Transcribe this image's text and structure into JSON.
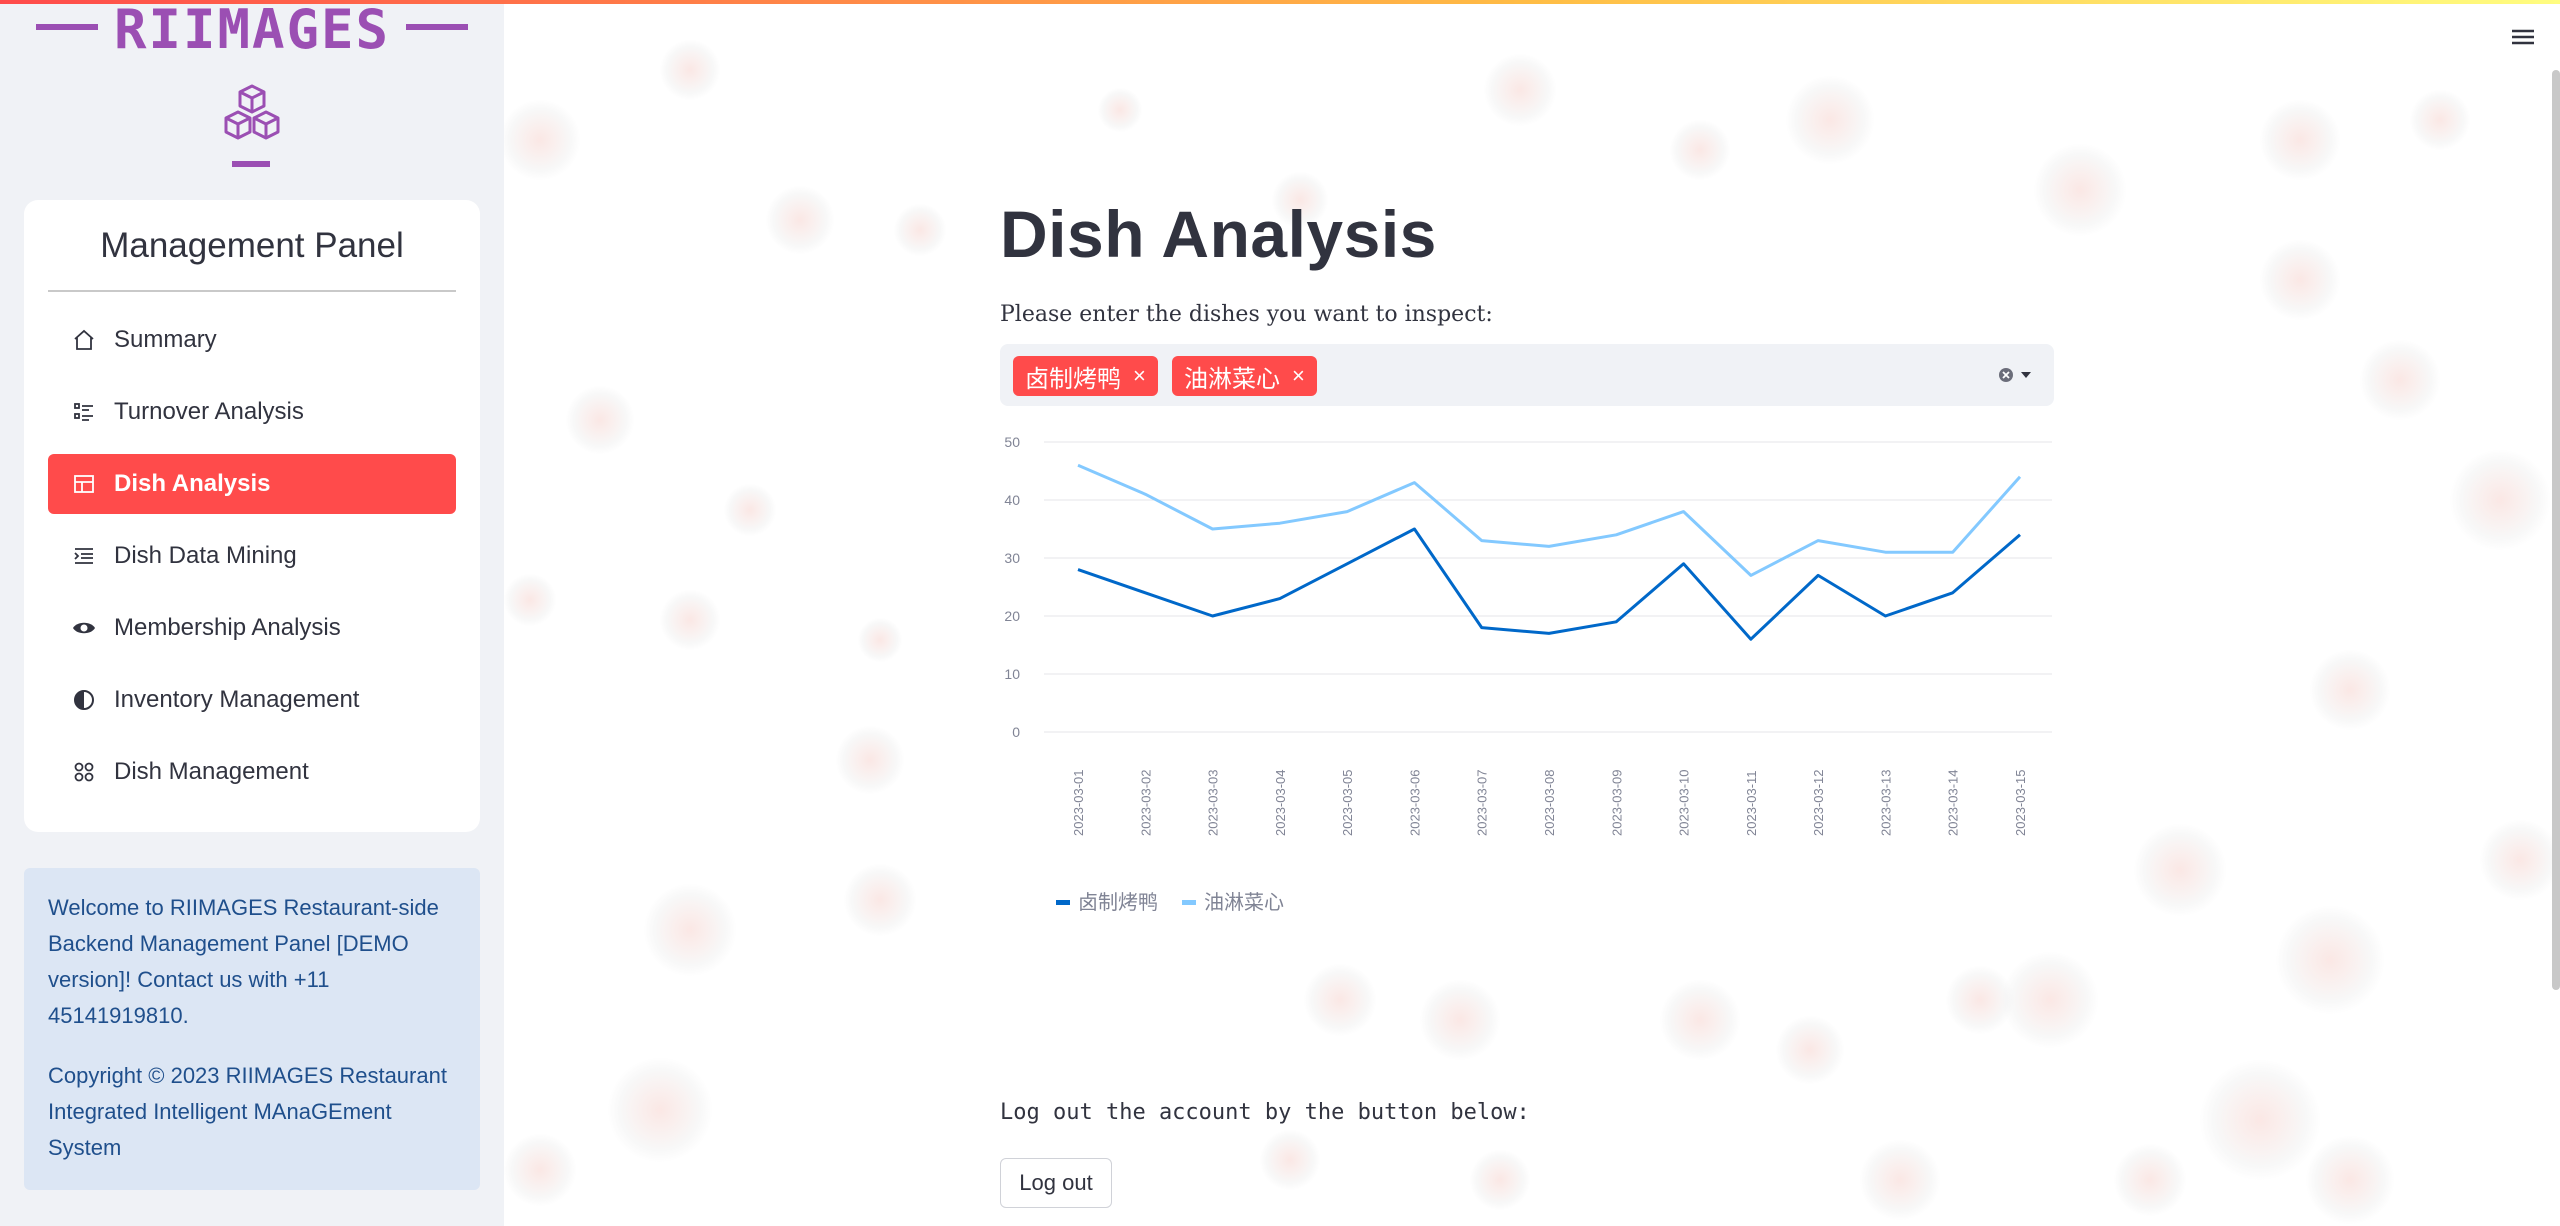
{
  "logo": {
    "text": "RIIMAGES",
    "icon": "cubes-icon",
    "color": "#9b4fb3"
  },
  "sidebar": {
    "panel_title": "Management Panel",
    "items": [
      {
        "label": "Summary",
        "icon": "home-icon"
      },
      {
        "label": "Turnover Analysis",
        "icon": "list-check-icon"
      },
      {
        "label": "Dish Analysis",
        "icon": "layout-icon",
        "active": true
      },
      {
        "label": "Dish Data Mining",
        "icon": "text-indent-icon"
      },
      {
        "label": "Membership Analysis",
        "icon": "eye-icon"
      },
      {
        "label": "Inventory Management",
        "icon": "half-circle-icon"
      },
      {
        "label": "Dish Management",
        "icon": "grid-dots-icon"
      }
    ],
    "info_welcome": "Welcome to RIIMAGES Restaurant-side Backend Management Panel [DEMO version]! Contact us with +11 45141919810.",
    "info_copyright": "Copyright © 2023 RIIMAGES Restaurant Integrated Intelligent MAnaGEment System"
  },
  "main": {
    "title": "Dish Analysis",
    "prompt": "Please enter the dishes you want to inspect:",
    "selected_dishes": [
      "卤制烤鸭",
      "油淋菜心"
    ],
    "chip_remove": "×",
    "logout_label": "Log out the account by the button below:",
    "logout_button": "Log out"
  },
  "colors": {
    "accent": "#ff4b4b",
    "sidebar_bg": "#f0f2f6",
    "series1": "#0068c9",
    "series2": "#83c9ff"
  },
  "chart_data": {
    "type": "line",
    "x": [
      "2023-03-01",
      "2023-03-02",
      "2023-03-03",
      "2023-03-04",
      "2023-03-05",
      "2023-03-06",
      "2023-03-07",
      "2023-03-08",
      "2023-03-09",
      "2023-03-10",
      "2023-03-11",
      "2023-03-12",
      "2023-03-13",
      "2023-03-14",
      "2023-03-15"
    ],
    "series": [
      {
        "name": "卤制烤鸭",
        "values": [
          28,
          24,
          20,
          23,
          29,
          35,
          18,
          17,
          19,
          29,
          16,
          27,
          20,
          24,
          34
        ],
        "color": "#0068c9"
      },
      {
        "name": "油淋菜心",
        "values": [
          46,
          41,
          35,
          36,
          38,
          43,
          33,
          32,
          34,
          38,
          27,
          33,
          31,
          31,
          44
        ],
        "color": "#83c9ff"
      }
    ],
    "yticks": [
      0,
      10,
      20,
      30,
      40,
      50
    ],
    "ylim": [
      0,
      50
    ],
    "grid": true,
    "legend": "bottom-left"
  }
}
